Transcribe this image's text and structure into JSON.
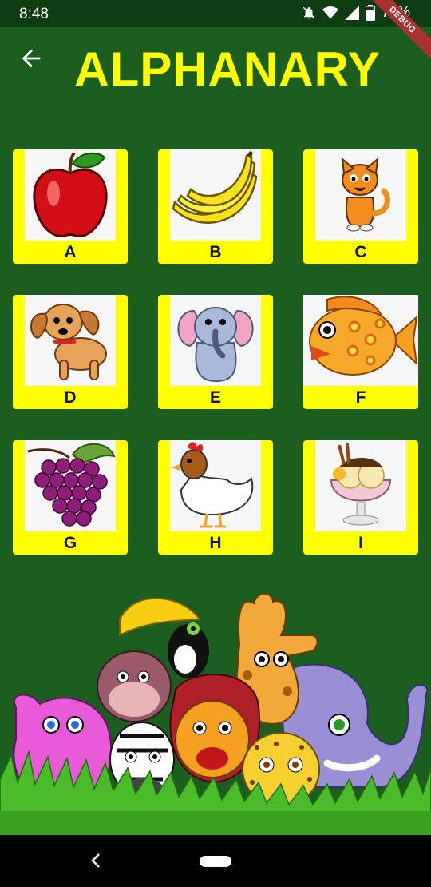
{
  "status_bar": {
    "time": "8:48",
    "battery": "77%",
    "debug_banner": "DEBUG"
  },
  "header": {
    "title": "ALPHANARY",
    "back_icon": "arrow-left-icon"
  },
  "cards": [
    {
      "letter": "A",
      "image": "apple"
    },
    {
      "letter": "B",
      "image": "banana"
    },
    {
      "letter": "C",
      "image": "cat"
    },
    {
      "letter": "D",
      "image": "dog"
    },
    {
      "letter": "E",
      "image": "elephant"
    },
    {
      "letter": "F",
      "image": "fish"
    },
    {
      "letter": "G",
      "image": "grapes"
    },
    {
      "letter": "H",
      "image": "hen"
    },
    {
      "letter": "I",
      "image": "ice-cream"
    }
  ],
  "colors": {
    "background": "#1b5e20",
    "title": "#ffff00",
    "card": "#ffff00"
  }
}
